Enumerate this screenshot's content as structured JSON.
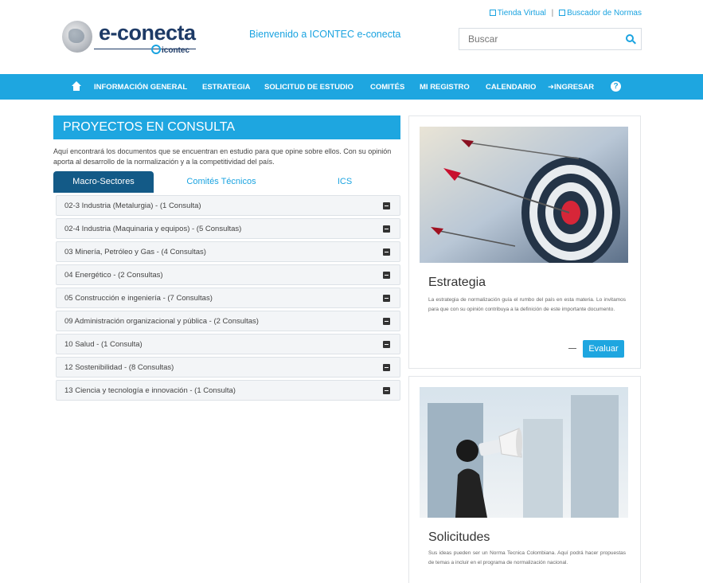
{
  "header": {
    "top_links": [
      "Tienda Virtual",
      "Buscador de Normas"
    ],
    "top_sep": "|",
    "logo_text": "e-conecta",
    "logo_sub": "icontec",
    "welcome": "Bienvenido a ICONTEC e-conecta",
    "search_placeholder": "Buscar"
  },
  "nav": {
    "items": [
      "INFORMACIÓN GENERAL",
      "ESTRATEGIA",
      "SOLICITUD DE ESTUDIO",
      "COMITÉS",
      "MI REGISTRO",
      "CALENDARIO",
      "INGRESAR"
    ],
    "help": "?"
  },
  "projects": {
    "title": "PROYECTOS EN CONSULTA",
    "intro": "Aquí encontrará los documentos que se encuentran en estudio para que opine sobre ellos. Con su opinión aporta al desarrollo de la normalización y a la competitividad del país.",
    "tabs": [
      "Macro-Sectores",
      "Comités Técnicos",
      "ICS"
    ],
    "sectors": [
      "02-3 Industria (Metalurgia) - (1 Consulta)",
      "02-4 Industria (Maquinaria y equipos) - (5 Consultas)",
      "03 Minería, Petróleo y Gas - (4 Consultas)",
      "04 Energético - (2 Consultas)",
      "05 Construcción e ingeniería - (7 Consultas)",
      "09 Administración organizacional y pública - (2 Consultas)",
      "10 Salud - (1 Consulta)",
      "12 Sostenibilidad - (8 Consultas)",
      "13 Ciencia y tecnología e innovación - (1 Consulta)"
    ]
  },
  "cards": {
    "strategy": {
      "title": "Estrategia",
      "text": "La estrategia de normalización guía el rumbo del país en esta materia. Lo invitamos para que con su opinión contribuya a la definición de este importante documento.",
      "button": "Evaluar"
    },
    "requests": {
      "title": "Solicitudes",
      "text": "Sus ideas pueden ser un Norma Tecnica Colombiana. Aquí podrá hacer propuestas de temas a incluir en el programa de normalización nacional."
    }
  },
  "colors": {
    "accent": "#1ea6e0",
    "dark_tab": "#135a87",
    "logo": "#1d3a66"
  }
}
